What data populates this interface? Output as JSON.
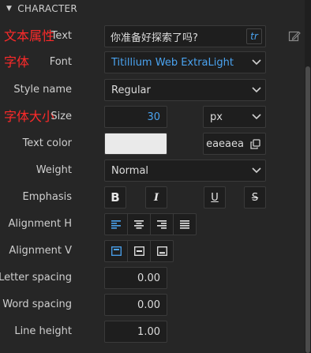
{
  "section": {
    "title": "CHARACTER"
  },
  "annotations": {
    "text": "文本属性",
    "font": "字体",
    "size": "字体大小"
  },
  "labels": {
    "text": "Text",
    "font": "Font",
    "style_name": "Style name",
    "size": "Size",
    "text_color": "Text color",
    "weight": "Weight",
    "emphasis": "Emphasis",
    "alignment_h": "Alignment H",
    "alignment_v": "Alignment V",
    "letter_spacing": "Letter spacing",
    "word_spacing": "Word spacing",
    "line_height": "Line height"
  },
  "fields": {
    "text_value": "你准备好探索了吗?",
    "tr_label": "tr",
    "font": "Titillium Web ExtraLight",
    "style_name": "Regular",
    "size": "30",
    "size_unit": "px",
    "color_hex": "eaeaea",
    "weight": "Normal",
    "letter_spacing": "0.00",
    "word_spacing": "0.00",
    "line_height": "1.00"
  },
  "emphasis": {
    "bold": "B",
    "italic": "I",
    "underline": "U",
    "strike": "S"
  },
  "colors": {
    "accent": "#4aa3f0",
    "swatch": "#eaeaea",
    "annotation": "#ff2a2a"
  },
  "icons": [
    "collapse-triangle-icon",
    "edit-icon",
    "chevron-down-icon",
    "copy-icon",
    "align-left-icon",
    "align-center-icon",
    "align-right-icon",
    "align-justify-icon",
    "align-top-icon",
    "align-middle-icon",
    "align-bottom-icon"
  ]
}
